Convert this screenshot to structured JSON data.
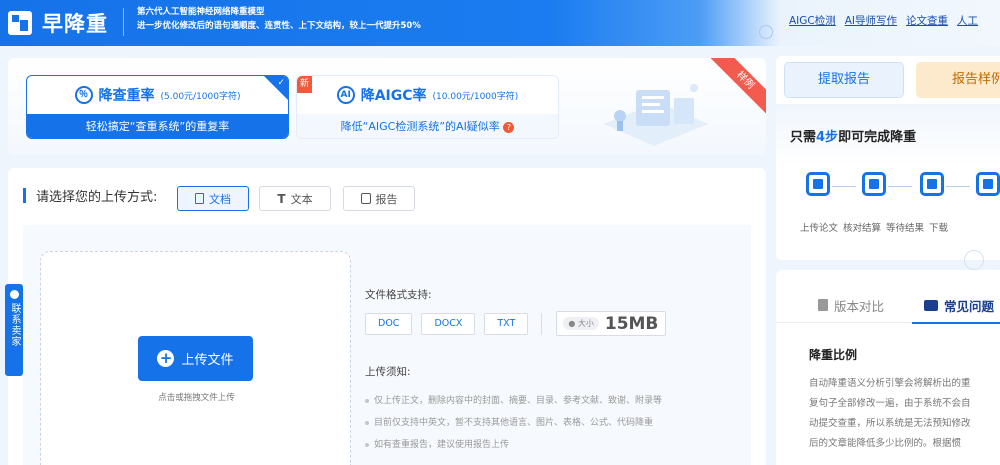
{
  "header": {
    "logo_text": "早降重",
    "tagline_line1": "第六代人工智能神经网络降重模型",
    "tagline_line2": "进一步优化修改后的语句通顺度、连贯性、上下文结构，较上一代提升50%",
    "nav": [
      "AIGC检测",
      "AI导师写作",
      "论文查重",
      "人工"
    ]
  },
  "services": {
    "card1": {
      "icon": "％",
      "title": "降查重率",
      "price": "(5.00元/1000字符)",
      "subtitle": "轻松搞定“查重系统”的重复率"
    },
    "card2": {
      "badge": "新",
      "icon": "AI",
      "title": "降AIGC率",
      "price": "(10.00元/1000字符)",
      "subtitle": "降低“AIGC检测系统”的AI疑似率"
    },
    "sample_ribbon": "样例"
  },
  "upload": {
    "method_label": "请选择您的上传方式:",
    "methods": [
      "文档",
      "文本",
      "报告"
    ],
    "upload_button": "上传文件",
    "upload_hint": "点击或拖拽文件上传",
    "format_label": "文件格式支持:",
    "formats": [
      "DOC",
      "DOCX",
      "TXT"
    ],
    "size_badge": "大小",
    "size_value": "15MB",
    "notice_label": "上传须知:",
    "notices": [
      "仅上传正文，删除内容中的封面、摘要、目录、参考文献、致谢、附录等",
      "目前仅支持中英文，暂不支持其他语言、图片、表格、公式、代码降重",
      "如有查重报告，建议使用报告上传"
    ]
  },
  "contact": {
    "label": "联系卖家"
  },
  "sidebar": {
    "extract_button": "提取报告",
    "sample_button": "报告样例",
    "steps_title_prefix": "只需",
    "steps_title_highlight": "4步",
    "steps_title_suffix": "即可完成降重",
    "steps": [
      "上传论文",
      "核对结算",
      "等待结果",
      "下载"
    ]
  },
  "faq": {
    "tabs": [
      "版本对比",
      "常见问题"
    ],
    "heading": "降重比例",
    "body": [
      "自动降重语义分析引擎会将解析出的重",
      "复句子全部修改一遍，由于系统不会自",
      "动提交查重，所以系统是无法预知修改",
      "后的文章能降低多少比例的。根据惯"
    ]
  },
  "colors": {
    "primary": "#1672e8",
    "accent_orange": "#f05a3a",
    "sample_bg": "#fdeacd"
  }
}
